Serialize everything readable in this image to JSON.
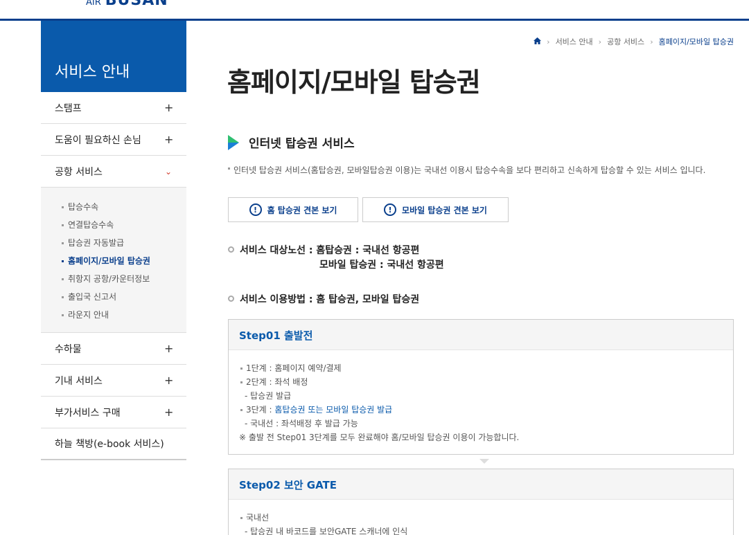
{
  "logo": {
    "air": "AIR",
    "busan": "BUSAN"
  },
  "sidebar": {
    "title": "서비스 안내",
    "items": [
      {
        "label": "스탬프",
        "symbol": "+"
      },
      {
        "label": "도움이 필요하신 손님",
        "symbol": "+"
      },
      {
        "label": "공항 서비스",
        "symbol": "⌄"
      }
    ],
    "subitems": [
      "탑승수속",
      "연결탑승수속",
      "탑승권 자동발급",
      "홈페이지/모바일 탑승권",
      "취항지 공항/카운터정보",
      "출입국 신고서",
      "라운지 안내"
    ],
    "items_after": [
      {
        "label": "수하물",
        "symbol": "+"
      },
      {
        "label": "기내 서비스",
        "symbol": "+"
      },
      {
        "label": "부가서비스 구매",
        "symbol": "+"
      },
      {
        "label": "하늘 책방(e-book 서비스)",
        "symbol": ""
      }
    ]
  },
  "breadcrumb": {
    "items": [
      "서비스 안내",
      "공항 서비스"
    ],
    "current": "홈페이지/모바일 탑승권"
  },
  "page_title": "홈페이지/모바일 탑승권",
  "section_title": "인터넷 탑승권 서비스",
  "description": "인터넷 탑승권 서비스(홈탑승권, 모바일탑승권 이용)는 국내선 이용시 탑승수속을 보다 편리하고 신속하게 탑승할 수 있는 서비스 입니다.",
  "buttons": {
    "home_sample": "홈 탑승권 견본 보기",
    "mobile_sample": "모바일 탑승권 견본 보기",
    "icon_glyph": "!"
  },
  "info": {
    "route_line": "서비스 대상노선 : 홈탑승권 : 국내선 항공편",
    "route_sub": "모바일 탑승권 : 국내선 항공편",
    "method_line": "서비스 이용방법 : 홈 탑승권, 모바일 탑승권"
  },
  "step1": {
    "title": "Step01 출발전",
    "line1": "1단계 : 홈페이지 예약/결제",
    "line2": "2단계 : 좌석 배정",
    "line2a": "- 탑승권 발급",
    "line3_prefix": "3단계 : ",
    "line3_highlight": "홈탑승권 또는 모바일 탑승권 발급",
    "line3a": "- 국내선 : 좌석배정 후 발급 가능",
    "note": "※ 출발 전 Step01 3단계를 모두 완료해야 홈/모바일 탑승권 이용이 가능합니다."
  },
  "step2": {
    "title": "Step02 보안 GATE",
    "line1": "국내선",
    "line1a": "- 탑승권 내 바코드를 보안GATE 스캐너에 인식"
  },
  "colors": {
    "brand": "#0a3f8c",
    "sidebar_header": "#0a5aab",
    "accent_red": "#d23a2a"
  }
}
